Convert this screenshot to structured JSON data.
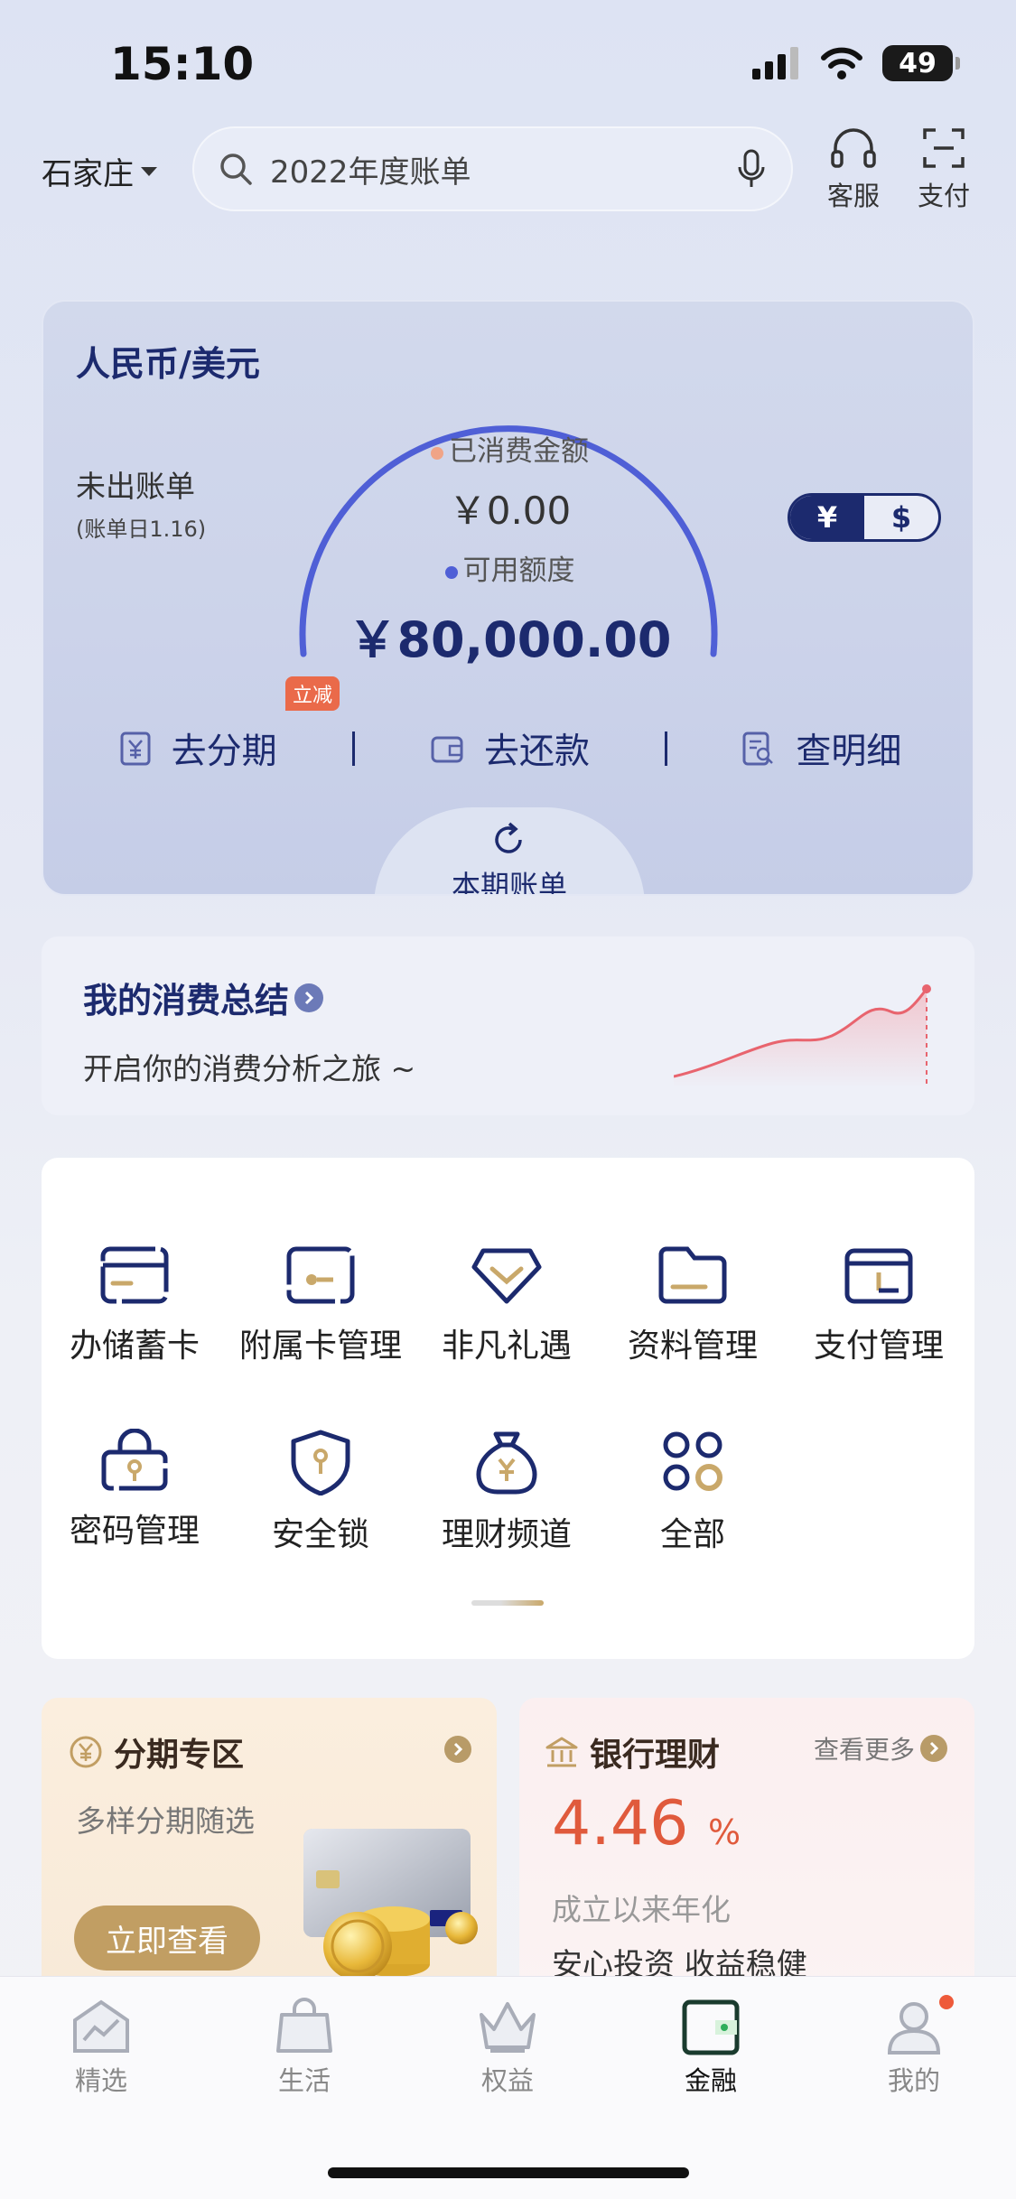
{
  "status_bar": {
    "time": "15:10",
    "battery": "49"
  },
  "header": {
    "city": "石家庄",
    "search_placeholder": "2022年度账单",
    "service_label": "客服",
    "pay_label": "支付"
  },
  "card_panel": {
    "currency_title": "人民币/美元",
    "unbilled_label": "未出账单",
    "bill_day": "(账单日1.16)",
    "spent_label": "已消费金额",
    "spent_value": "￥0.00",
    "available_label": "可用额度",
    "available_value": "￥80,000.00",
    "currency_toggle": {
      "cny": "¥",
      "usd": "$",
      "selected": "cny"
    },
    "discount_badge": "立减",
    "actions": [
      "去分期",
      "去还款",
      "查明细"
    ],
    "bill_tab_label": "本期账单",
    "colors": {
      "gauge": "#4f5fd6",
      "spent_dot": "#f0a487",
      "available_dot": "#4f5fd6",
      "navy": "#1c2a6e"
    }
  },
  "summary": {
    "title": "我的消费总结",
    "subtitle": "开启你的消费分析之旅 ~"
  },
  "quick_grid": {
    "items": [
      {
        "label": "办储蓄卡",
        "icon": "card-icon"
      },
      {
        "label": "附属卡管理",
        "icon": "wallet-card-icon"
      },
      {
        "label": "非凡礼遇",
        "icon": "diamond-icon"
      },
      {
        "label": "资料管理",
        "icon": "folder-icon"
      },
      {
        "label": "支付管理",
        "icon": "wallet-icon"
      },
      {
        "label": "密码管理",
        "icon": "lock-icon"
      },
      {
        "label": "安全锁",
        "icon": "shield-icon"
      },
      {
        "label": "理财频道",
        "icon": "money-bag-icon"
      },
      {
        "label": "全部",
        "icon": "grid-circles-icon"
      }
    ]
  },
  "installment_card": {
    "title": "分期专区",
    "subtitle": "多样分期随选",
    "button": "立即查看"
  },
  "wealth_card": {
    "title": "银行理财",
    "more": "查看更多",
    "rate": "4.46",
    "rate_unit": "%",
    "rate_label": "成立以来年化",
    "tagline": "安心投资 收益稳健"
  },
  "tab_bar": {
    "tabs": [
      {
        "label": "精选",
        "icon": "home-icon"
      },
      {
        "label": "生活",
        "icon": "shopping-bag-icon"
      },
      {
        "label": "权益",
        "icon": "crown-icon"
      },
      {
        "label": "金融",
        "icon": "finance-wallet-icon"
      },
      {
        "label": "我的",
        "icon": "profile-icon"
      }
    ],
    "active": "金融"
  }
}
